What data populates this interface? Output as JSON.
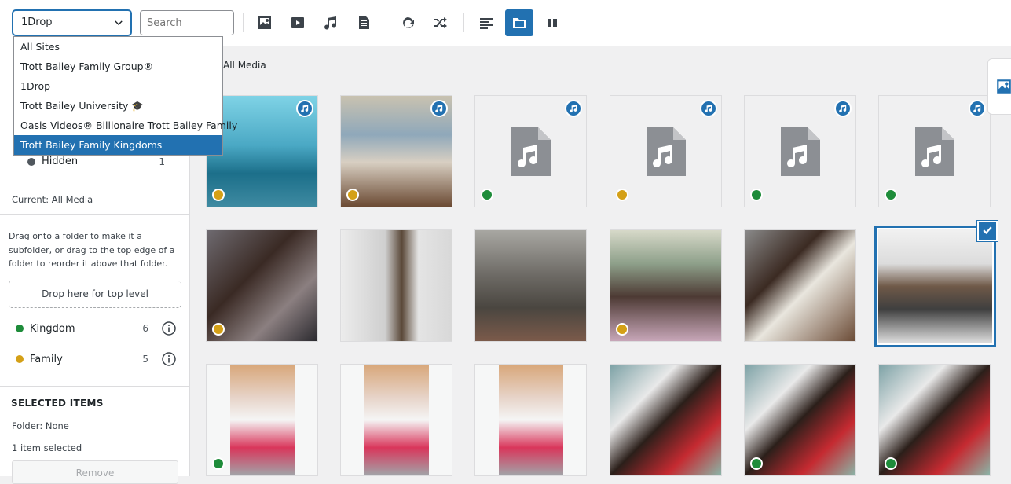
{
  "toolbar": {
    "site_value": "1Drop",
    "search_placeholder": "Search"
  },
  "dropdown": {
    "options": [
      "All Sites",
      "Trott Bailey Family Group®",
      "1Drop",
      "Trott Bailey University 🎓",
      "Oasis Videos® Billionaire Trott Bailey Family",
      "Trott Bailey Family Kingdoms"
    ],
    "selected_index": 5
  },
  "sidebar": {
    "hidden_label": "Hidden",
    "hidden_count": "1",
    "current": "Current: All Media",
    "help": "Drag onto a folder to make it a subfolder, or drag to the top edge of a folder to reorder it above that folder.",
    "drop_zone": "Drop here for top level",
    "folders": [
      {
        "name": "Kingdom",
        "count": "6",
        "color": "#1e8c3a"
      },
      {
        "name": "Family",
        "count": "5",
        "color": "#d4a017"
      }
    ],
    "selected_title": "SELECTED ITEMS",
    "folder_line": "Folder: None",
    "count_line": "1 item selected",
    "remove": "Remove"
  },
  "breadcrumb": "All Media",
  "colors": {
    "accent": "#2271b1",
    "status_green": "#1e8c3a",
    "status_gold": "#d4a017"
  },
  "tiles": [
    {
      "kind": "photo",
      "audio": true,
      "status": "gold",
      "scene": "art"
    },
    {
      "kind": "photo",
      "audio": true,
      "status": "gold",
      "scene": "beach"
    },
    {
      "kind": "file",
      "audio": true,
      "status": "green"
    },
    {
      "kind": "file",
      "audio": true,
      "status": "gold"
    },
    {
      "kind": "file",
      "audio": true,
      "status": "green"
    },
    {
      "kind": "file",
      "audio": true,
      "status": "green"
    },
    {
      "kind": "photo",
      "audio": false,
      "status": "gold",
      "scene": "family"
    },
    {
      "kind": "photo",
      "audio": false,
      "status": "",
      "scene": "room"
    },
    {
      "kind": "photo",
      "audio": false,
      "status": "",
      "scene": "tree"
    },
    {
      "kind": "photo",
      "audio": false,
      "status": "gold",
      "scene": "group"
    },
    {
      "kind": "photo",
      "audio": false,
      "status": "",
      "scene": "baby"
    },
    {
      "kind": "photo",
      "audio": false,
      "status": "",
      "scene": "man",
      "selected": true
    },
    {
      "kind": "photo",
      "audio": false,
      "status": "green",
      "scene": "kids"
    },
    {
      "kind": "photo",
      "audio": false,
      "status": "",
      "scene": "kids"
    },
    {
      "kind": "photo",
      "audio": false,
      "status": "",
      "scene": "kids"
    },
    {
      "kind": "photo",
      "audio": false,
      "status": "",
      "scene": "hug"
    },
    {
      "kind": "photo",
      "audio": false,
      "status": "green",
      "scene": "hug"
    },
    {
      "kind": "photo",
      "audio": false,
      "status": "green",
      "scene": "hug"
    }
  ]
}
